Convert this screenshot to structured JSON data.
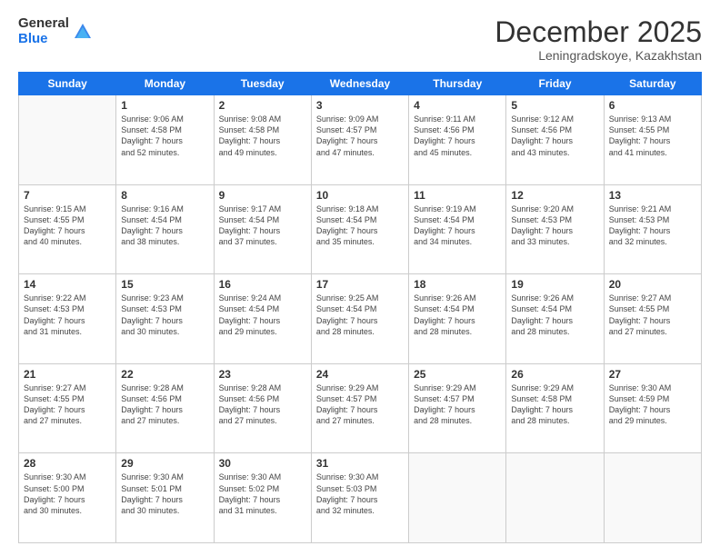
{
  "logo": {
    "general": "General",
    "blue": "Blue"
  },
  "header": {
    "month_year": "December 2025",
    "location": "Leningradskoye, Kazakhstan"
  },
  "days_of_week": [
    "Sunday",
    "Monday",
    "Tuesday",
    "Wednesday",
    "Thursday",
    "Friday",
    "Saturday"
  ],
  "weeks": [
    [
      {
        "day": "",
        "content": ""
      },
      {
        "day": "1",
        "content": "Sunrise: 9:06 AM\nSunset: 4:58 PM\nDaylight: 7 hours\nand 52 minutes."
      },
      {
        "day": "2",
        "content": "Sunrise: 9:08 AM\nSunset: 4:58 PM\nDaylight: 7 hours\nand 49 minutes."
      },
      {
        "day": "3",
        "content": "Sunrise: 9:09 AM\nSunset: 4:57 PM\nDaylight: 7 hours\nand 47 minutes."
      },
      {
        "day": "4",
        "content": "Sunrise: 9:11 AM\nSunset: 4:56 PM\nDaylight: 7 hours\nand 45 minutes."
      },
      {
        "day": "5",
        "content": "Sunrise: 9:12 AM\nSunset: 4:56 PM\nDaylight: 7 hours\nand 43 minutes."
      },
      {
        "day": "6",
        "content": "Sunrise: 9:13 AM\nSunset: 4:55 PM\nDaylight: 7 hours\nand 41 minutes."
      }
    ],
    [
      {
        "day": "7",
        "content": "Sunrise: 9:15 AM\nSunset: 4:55 PM\nDaylight: 7 hours\nand 40 minutes."
      },
      {
        "day": "8",
        "content": "Sunrise: 9:16 AM\nSunset: 4:54 PM\nDaylight: 7 hours\nand 38 minutes."
      },
      {
        "day": "9",
        "content": "Sunrise: 9:17 AM\nSunset: 4:54 PM\nDaylight: 7 hours\nand 37 minutes."
      },
      {
        "day": "10",
        "content": "Sunrise: 9:18 AM\nSunset: 4:54 PM\nDaylight: 7 hours\nand 35 minutes."
      },
      {
        "day": "11",
        "content": "Sunrise: 9:19 AM\nSunset: 4:54 PM\nDaylight: 7 hours\nand 34 minutes."
      },
      {
        "day": "12",
        "content": "Sunrise: 9:20 AM\nSunset: 4:53 PM\nDaylight: 7 hours\nand 33 minutes."
      },
      {
        "day": "13",
        "content": "Sunrise: 9:21 AM\nSunset: 4:53 PM\nDaylight: 7 hours\nand 32 minutes."
      }
    ],
    [
      {
        "day": "14",
        "content": "Sunrise: 9:22 AM\nSunset: 4:53 PM\nDaylight: 7 hours\nand 31 minutes."
      },
      {
        "day": "15",
        "content": "Sunrise: 9:23 AM\nSunset: 4:53 PM\nDaylight: 7 hours\nand 30 minutes."
      },
      {
        "day": "16",
        "content": "Sunrise: 9:24 AM\nSunset: 4:54 PM\nDaylight: 7 hours\nand 29 minutes."
      },
      {
        "day": "17",
        "content": "Sunrise: 9:25 AM\nSunset: 4:54 PM\nDaylight: 7 hours\nand 28 minutes."
      },
      {
        "day": "18",
        "content": "Sunrise: 9:26 AM\nSunset: 4:54 PM\nDaylight: 7 hours\nand 28 minutes."
      },
      {
        "day": "19",
        "content": "Sunrise: 9:26 AM\nSunset: 4:54 PM\nDaylight: 7 hours\nand 28 minutes."
      },
      {
        "day": "20",
        "content": "Sunrise: 9:27 AM\nSunset: 4:55 PM\nDaylight: 7 hours\nand 27 minutes."
      }
    ],
    [
      {
        "day": "21",
        "content": "Sunrise: 9:27 AM\nSunset: 4:55 PM\nDaylight: 7 hours\nand 27 minutes."
      },
      {
        "day": "22",
        "content": "Sunrise: 9:28 AM\nSunset: 4:56 PM\nDaylight: 7 hours\nand 27 minutes."
      },
      {
        "day": "23",
        "content": "Sunrise: 9:28 AM\nSunset: 4:56 PM\nDaylight: 7 hours\nand 27 minutes."
      },
      {
        "day": "24",
        "content": "Sunrise: 9:29 AM\nSunset: 4:57 PM\nDaylight: 7 hours\nand 27 minutes."
      },
      {
        "day": "25",
        "content": "Sunrise: 9:29 AM\nSunset: 4:57 PM\nDaylight: 7 hours\nand 28 minutes."
      },
      {
        "day": "26",
        "content": "Sunrise: 9:29 AM\nSunset: 4:58 PM\nDaylight: 7 hours\nand 28 minutes."
      },
      {
        "day": "27",
        "content": "Sunrise: 9:30 AM\nSunset: 4:59 PM\nDaylight: 7 hours\nand 29 minutes."
      }
    ],
    [
      {
        "day": "28",
        "content": "Sunrise: 9:30 AM\nSunset: 5:00 PM\nDaylight: 7 hours\nand 30 minutes."
      },
      {
        "day": "29",
        "content": "Sunrise: 9:30 AM\nSunset: 5:01 PM\nDaylight: 7 hours\nand 30 minutes."
      },
      {
        "day": "30",
        "content": "Sunrise: 9:30 AM\nSunset: 5:02 PM\nDaylight: 7 hours\nand 31 minutes."
      },
      {
        "day": "31",
        "content": "Sunrise: 9:30 AM\nSunset: 5:03 PM\nDaylight: 7 hours\nand 32 minutes."
      },
      {
        "day": "",
        "content": ""
      },
      {
        "day": "",
        "content": ""
      },
      {
        "day": "",
        "content": ""
      }
    ]
  ]
}
